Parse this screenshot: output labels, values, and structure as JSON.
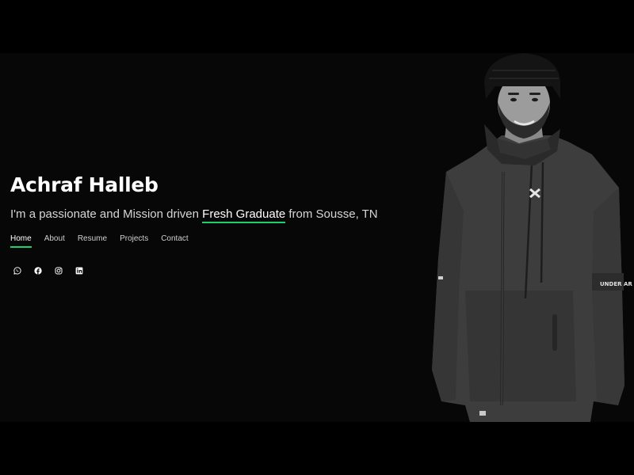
{
  "hero": {
    "name": "Achraf Halleb",
    "tagline_before": "I'm a passionate and Mission driven ",
    "tagline_highlight": "Fresh Graduate",
    "tagline_after": " from Sousse, TN"
  },
  "nav": {
    "items": [
      {
        "label": "Home",
        "active": true
      },
      {
        "label": "About",
        "active": false
      },
      {
        "label": "Resume",
        "active": false
      },
      {
        "label": "Projects",
        "active": false
      },
      {
        "label": "Contact",
        "active": false
      }
    ]
  },
  "social": {
    "icons": [
      "whatsapp-icon",
      "facebook-icon",
      "instagram-icon",
      "linkedin-icon"
    ]
  },
  "photo": {
    "jacket_text": "UNDER AR"
  },
  "colors": {
    "accent": "#18d26e",
    "background": "#000000",
    "hero_background": "#070707",
    "text": "#ffffff"
  }
}
